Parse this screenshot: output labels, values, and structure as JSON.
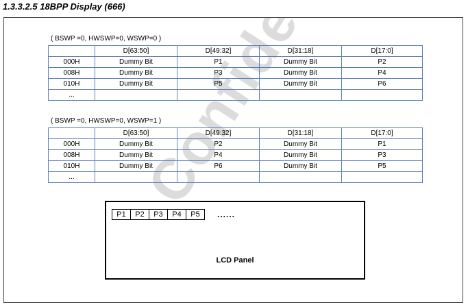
{
  "heading": "1.3.3.2.5 18BPP Display (666)",
  "watermark": "Confidential",
  "tables": [
    {
      "caption": "( BSWP =0, HWSWP=0, WSWP=0 )",
      "headers": [
        "",
        "D[63:50]",
        "D[49:32]",
        "D[31:18]",
        "D[17:0]"
      ],
      "rows": [
        [
          "000H",
          "Dummy Bit",
          "P1",
          "Dummy Bit",
          "P2"
        ],
        [
          "008H",
          "Dummy Bit",
          "P3",
          "Dummy Bit",
          "P4"
        ],
        [
          "010H",
          "Dummy Bit",
          "P5",
          "Dummy Bit",
          "P6"
        ],
        [
          "...",
          "",
          "",
          "",
          ""
        ]
      ]
    },
    {
      "caption": "( BSWP =0, HWSWP=0, WSWP=1 )",
      "headers": [
        "",
        "D[63:50]",
        "D[49:32]",
        "D[31:18]",
        "D[17:0]"
      ],
      "rows": [
        [
          "000H",
          "Dummy Bit",
          "P2",
          "Dummy Bit",
          "P1"
        ],
        [
          "008H",
          "Dummy Bit",
          "P4",
          "Dummy Bit",
          "P3"
        ],
        [
          "010H",
          "Dummy Bit",
          "P6",
          "Dummy Bit",
          "P5"
        ],
        [
          "...",
          "",
          "",
          "",
          ""
        ]
      ]
    }
  ],
  "panel": {
    "pixels": [
      "P1",
      "P2",
      "P3",
      "P4",
      "P5"
    ],
    "continuation": "......",
    "label": "LCD Panel"
  }
}
